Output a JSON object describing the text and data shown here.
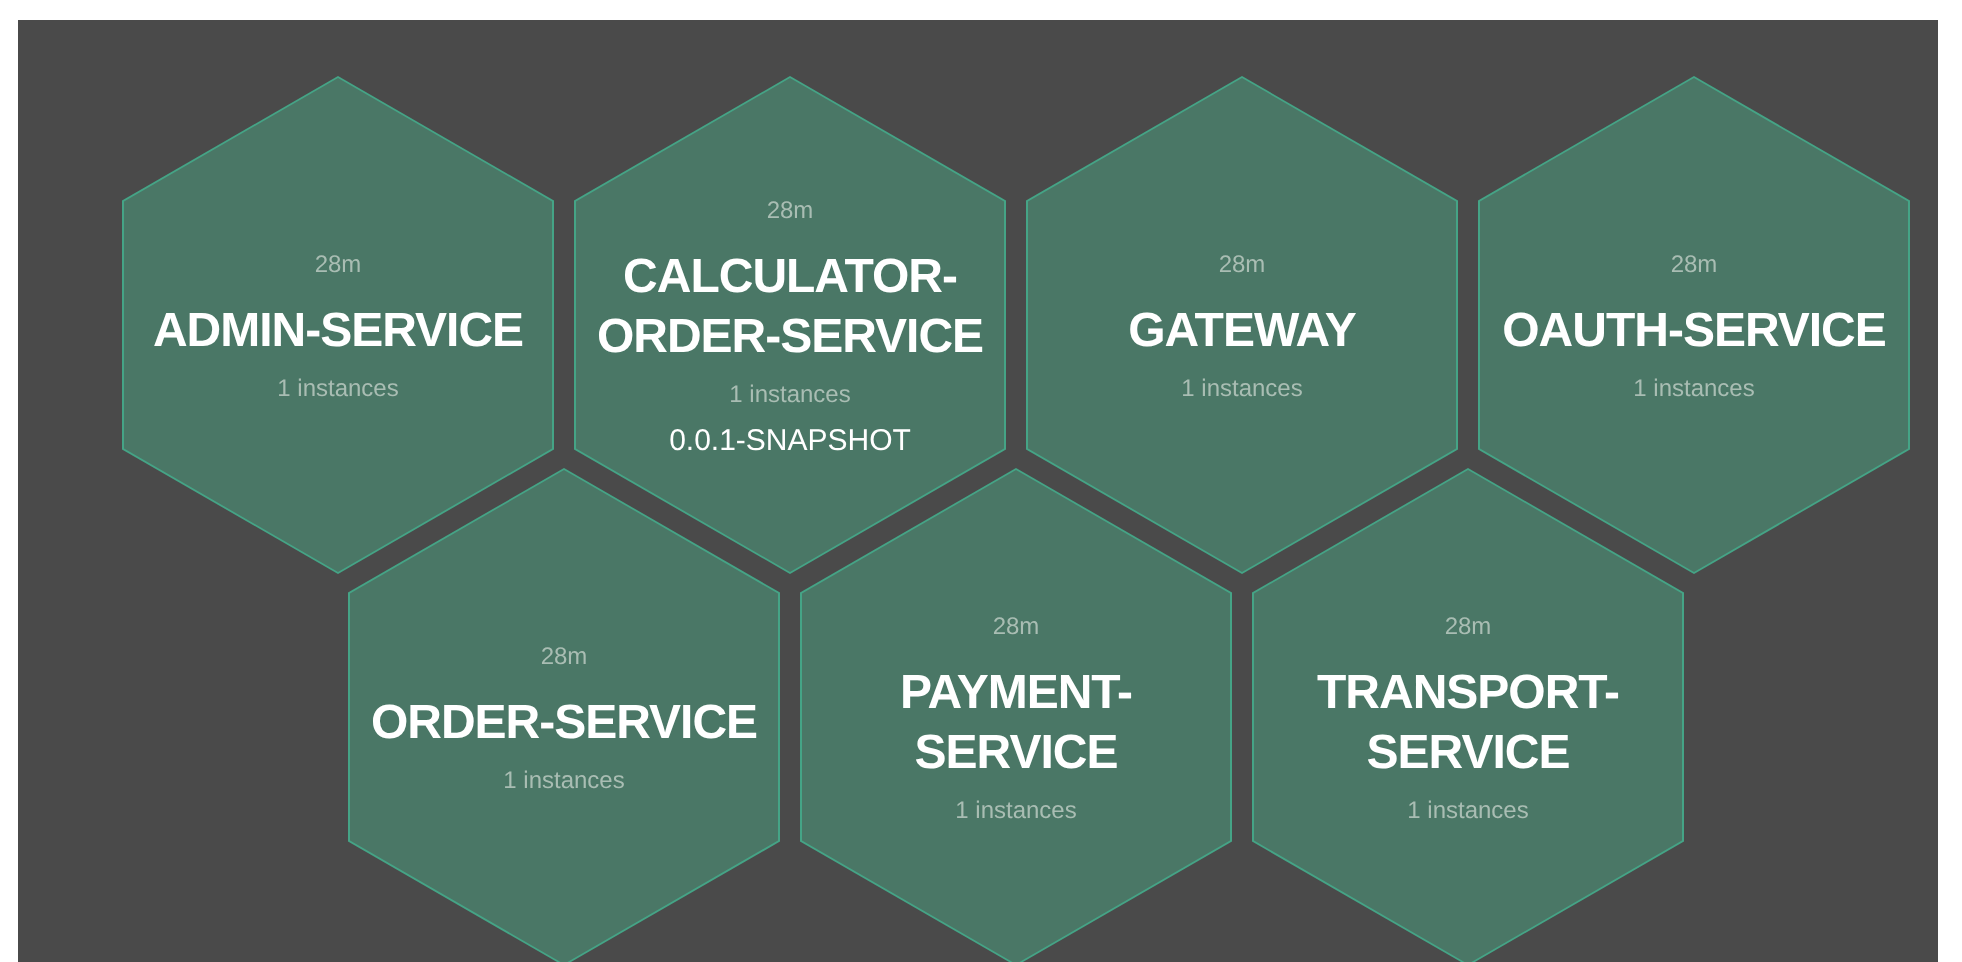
{
  "rows": [
    {
      "applications": [
        {
          "uptime": "28m",
          "name": "ADMIN-SERVICE",
          "instances": "1 instances"
        },
        {
          "uptime": "28m",
          "name": "CALCULATOR-ORDER-SERVICE",
          "instances": "1 instances",
          "version": "0.0.1-SNAPSHOT"
        },
        {
          "uptime": "28m",
          "name": "GATEWAY",
          "instances": "1 instances"
        },
        {
          "uptime": "28m",
          "name": "OAUTH-SERVICE",
          "instances": "1 instances"
        }
      ]
    },
    {
      "applications": [
        {
          "uptime": "28m",
          "name": "ORDER-SERVICE",
          "instances": "1 instances"
        },
        {
          "uptime": "28m",
          "name": "PAYMENT-SERVICE",
          "instances": "1 instances"
        },
        {
          "uptime": "28m",
          "name": "TRANSPORT-SERVICE",
          "instances": "1 instances"
        }
      ]
    }
  ]
}
